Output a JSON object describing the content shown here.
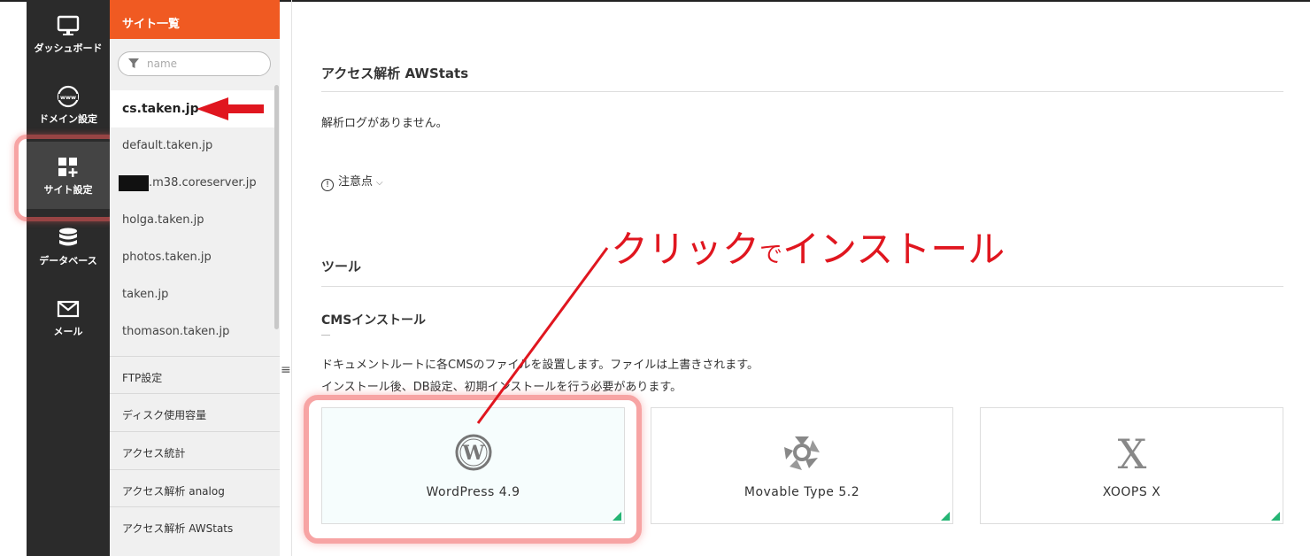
{
  "rail": {
    "items": [
      {
        "label": "ダッシュボード",
        "icon": "monitor-icon"
      },
      {
        "label": "ドメイン設定",
        "icon": "www-globe-icon"
      },
      {
        "label": "サイト設定",
        "icon": "site-grid-plus-icon"
      },
      {
        "label": "データベース",
        "icon": "database-icon"
      },
      {
        "label": "メール",
        "icon": "envelope-icon"
      }
    ],
    "active_index": 2
  },
  "site_list": {
    "title": "サイト一覧",
    "filter_placeholder": "name",
    "sites": [
      "cs.taken.jp",
      "default.taken.jp",
      ".m38.coreserver.jp",
      "holga.taken.jp",
      "photos.taken.jp",
      "taken.jp",
      "thomason.taken.jp"
    ],
    "selected_index": 0,
    "menu": [
      "FTP設定",
      "ディスク使用容量",
      "アクセス統計",
      "アクセス解析 analog",
      "アクセス解析 AWStats"
    ]
  },
  "main": {
    "section_title": "アクセス解析 AWStats",
    "no_log_message": "解析ログがありません。",
    "notes_label": "注意点",
    "tools_title": "ツール",
    "cms_title": "CMSインストール",
    "cms_desc_1": "ドキュメントルートに各CMSのファイルを設置します。ファイルは上書きされます。",
    "cms_desc_2": "インストール後、DB設定、初期インストールを行う必要があります。",
    "cms_cards": [
      {
        "name": "WordPress 4.9",
        "icon": "wordpress-icon"
      },
      {
        "name": "Movable Type 5.2",
        "icon": "movable-type-icon"
      },
      {
        "name": "XOOPS X",
        "icon": "xoops-icon"
      }
    ]
  },
  "annotation": {
    "text_part_1": "クリック",
    "text_part_2": "で",
    "text_part_3": "インストール",
    "color": "#e0161f"
  },
  "colors": {
    "accent_orange": "#f05a22",
    "rail_bg": "#2b2b2b",
    "corner_green": "#25b574",
    "highlight_red": "#f05a5a"
  }
}
